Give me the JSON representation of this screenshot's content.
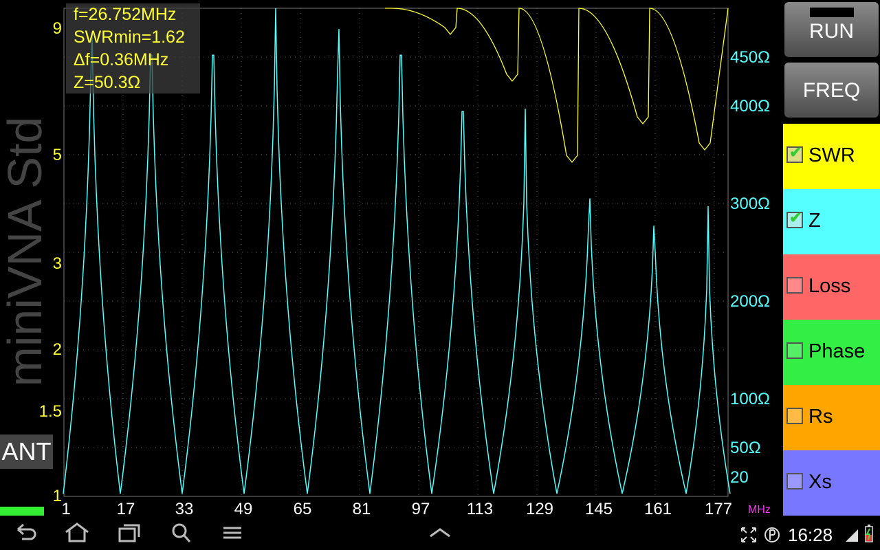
{
  "app": {
    "title": "miniVNA Std",
    "mode": "ANT"
  },
  "info": {
    "f": "f=26.752MHz",
    "swrmin": "SWRmin=1.62",
    "df": "Δf=0.36MHz",
    "z": "Z=50.3Ω"
  },
  "left_axis": {
    "labels": [
      "9",
      "5",
      "3",
      "2",
      "1.5",
      "1"
    ]
  },
  "right_axis": {
    "labels": [
      "450Ω",
      "400Ω",
      "300Ω",
      "200Ω",
      "100Ω",
      "50Ω",
      "20"
    ]
  },
  "x_axis": {
    "labels": [
      "1",
      "17",
      "33",
      "49",
      "65",
      "81",
      "97",
      "113",
      "129",
      "145",
      "161",
      "177"
    ],
    "unit": "MHz"
  },
  "buttons": {
    "run": "RUN",
    "freq": "FREQ"
  },
  "traces": [
    {
      "label": "SWR",
      "checked": true,
      "color": "#ffff00"
    },
    {
      "label": "Z",
      "checked": true,
      "color": "#55ffff"
    },
    {
      "label": "Loss",
      "checked": false,
      "color": "#ff6666"
    },
    {
      "label": "Phase",
      "checked": false,
      "color": "#33ee44"
    },
    {
      "label": "Rs",
      "checked": false,
      "color": "#ffa500"
    },
    {
      "label": "Xs",
      "checked": false,
      "color": "#7777ff"
    }
  ],
  "status": {
    "time": "16:28"
  },
  "colors": {
    "swr_trace": "#ffff33",
    "z_trace": "#55ffff",
    "grid": "#555555"
  }
}
